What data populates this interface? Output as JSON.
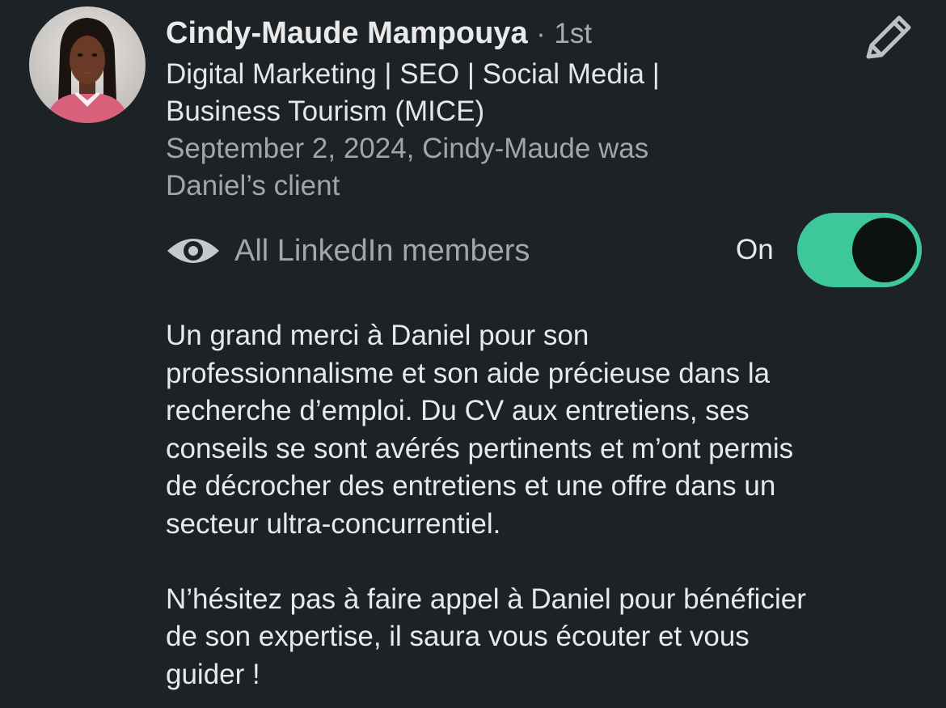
{
  "recommendation": {
    "author_name": "Cindy-Maude Mampouya",
    "separator": "·",
    "connection_degree": "1st",
    "headline_line1": "Digital Marketing | SEO | Social Media |",
    "headline_line2": "Business Tourism (MICE)",
    "relationship_line1": "September 2, 2024, Cindy-Maude was",
    "relationship_line2": "Daniel’s client",
    "paragraph1_line1": "Un grand merci à Daniel pour son",
    "paragraph1_line2": "professionnalisme et son aide précieuse dans la",
    "paragraph1_line3": "recherche d’emploi. Du CV aux entretiens, ses",
    "paragraph1_line4": "conseils se sont avérés pertinents et m’ont permis",
    "paragraph1_line5": "de décrocher des entretiens et une offre dans un",
    "paragraph1_line6": "secteur ultra-concurrentiel.",
    "paragraph2_line1": "N’hésitez pas à faire appel à Daniel pour bénéficier",
    "paragraph2_line2": "de son expertise, il saura vous écouter et vous",
    "paragraph2_line3": "guider !"
  },
  "visibility": {
    "icon": "eye-icon",
    "label": "All LinkedIn members",
    "toggle_state_label": "On",
    "toggle_on": true
  },
  "icons": {
    "edit": "pencil-icon",
    "avatar": "profile-photo"
  },
  "colors": {
    "background": "#1d2226",
    "toggle_on": "#3ec79a",
    "secondary_text": "#a5a6a7",
    "primary_text": "#e9e9ea"
  }
}
